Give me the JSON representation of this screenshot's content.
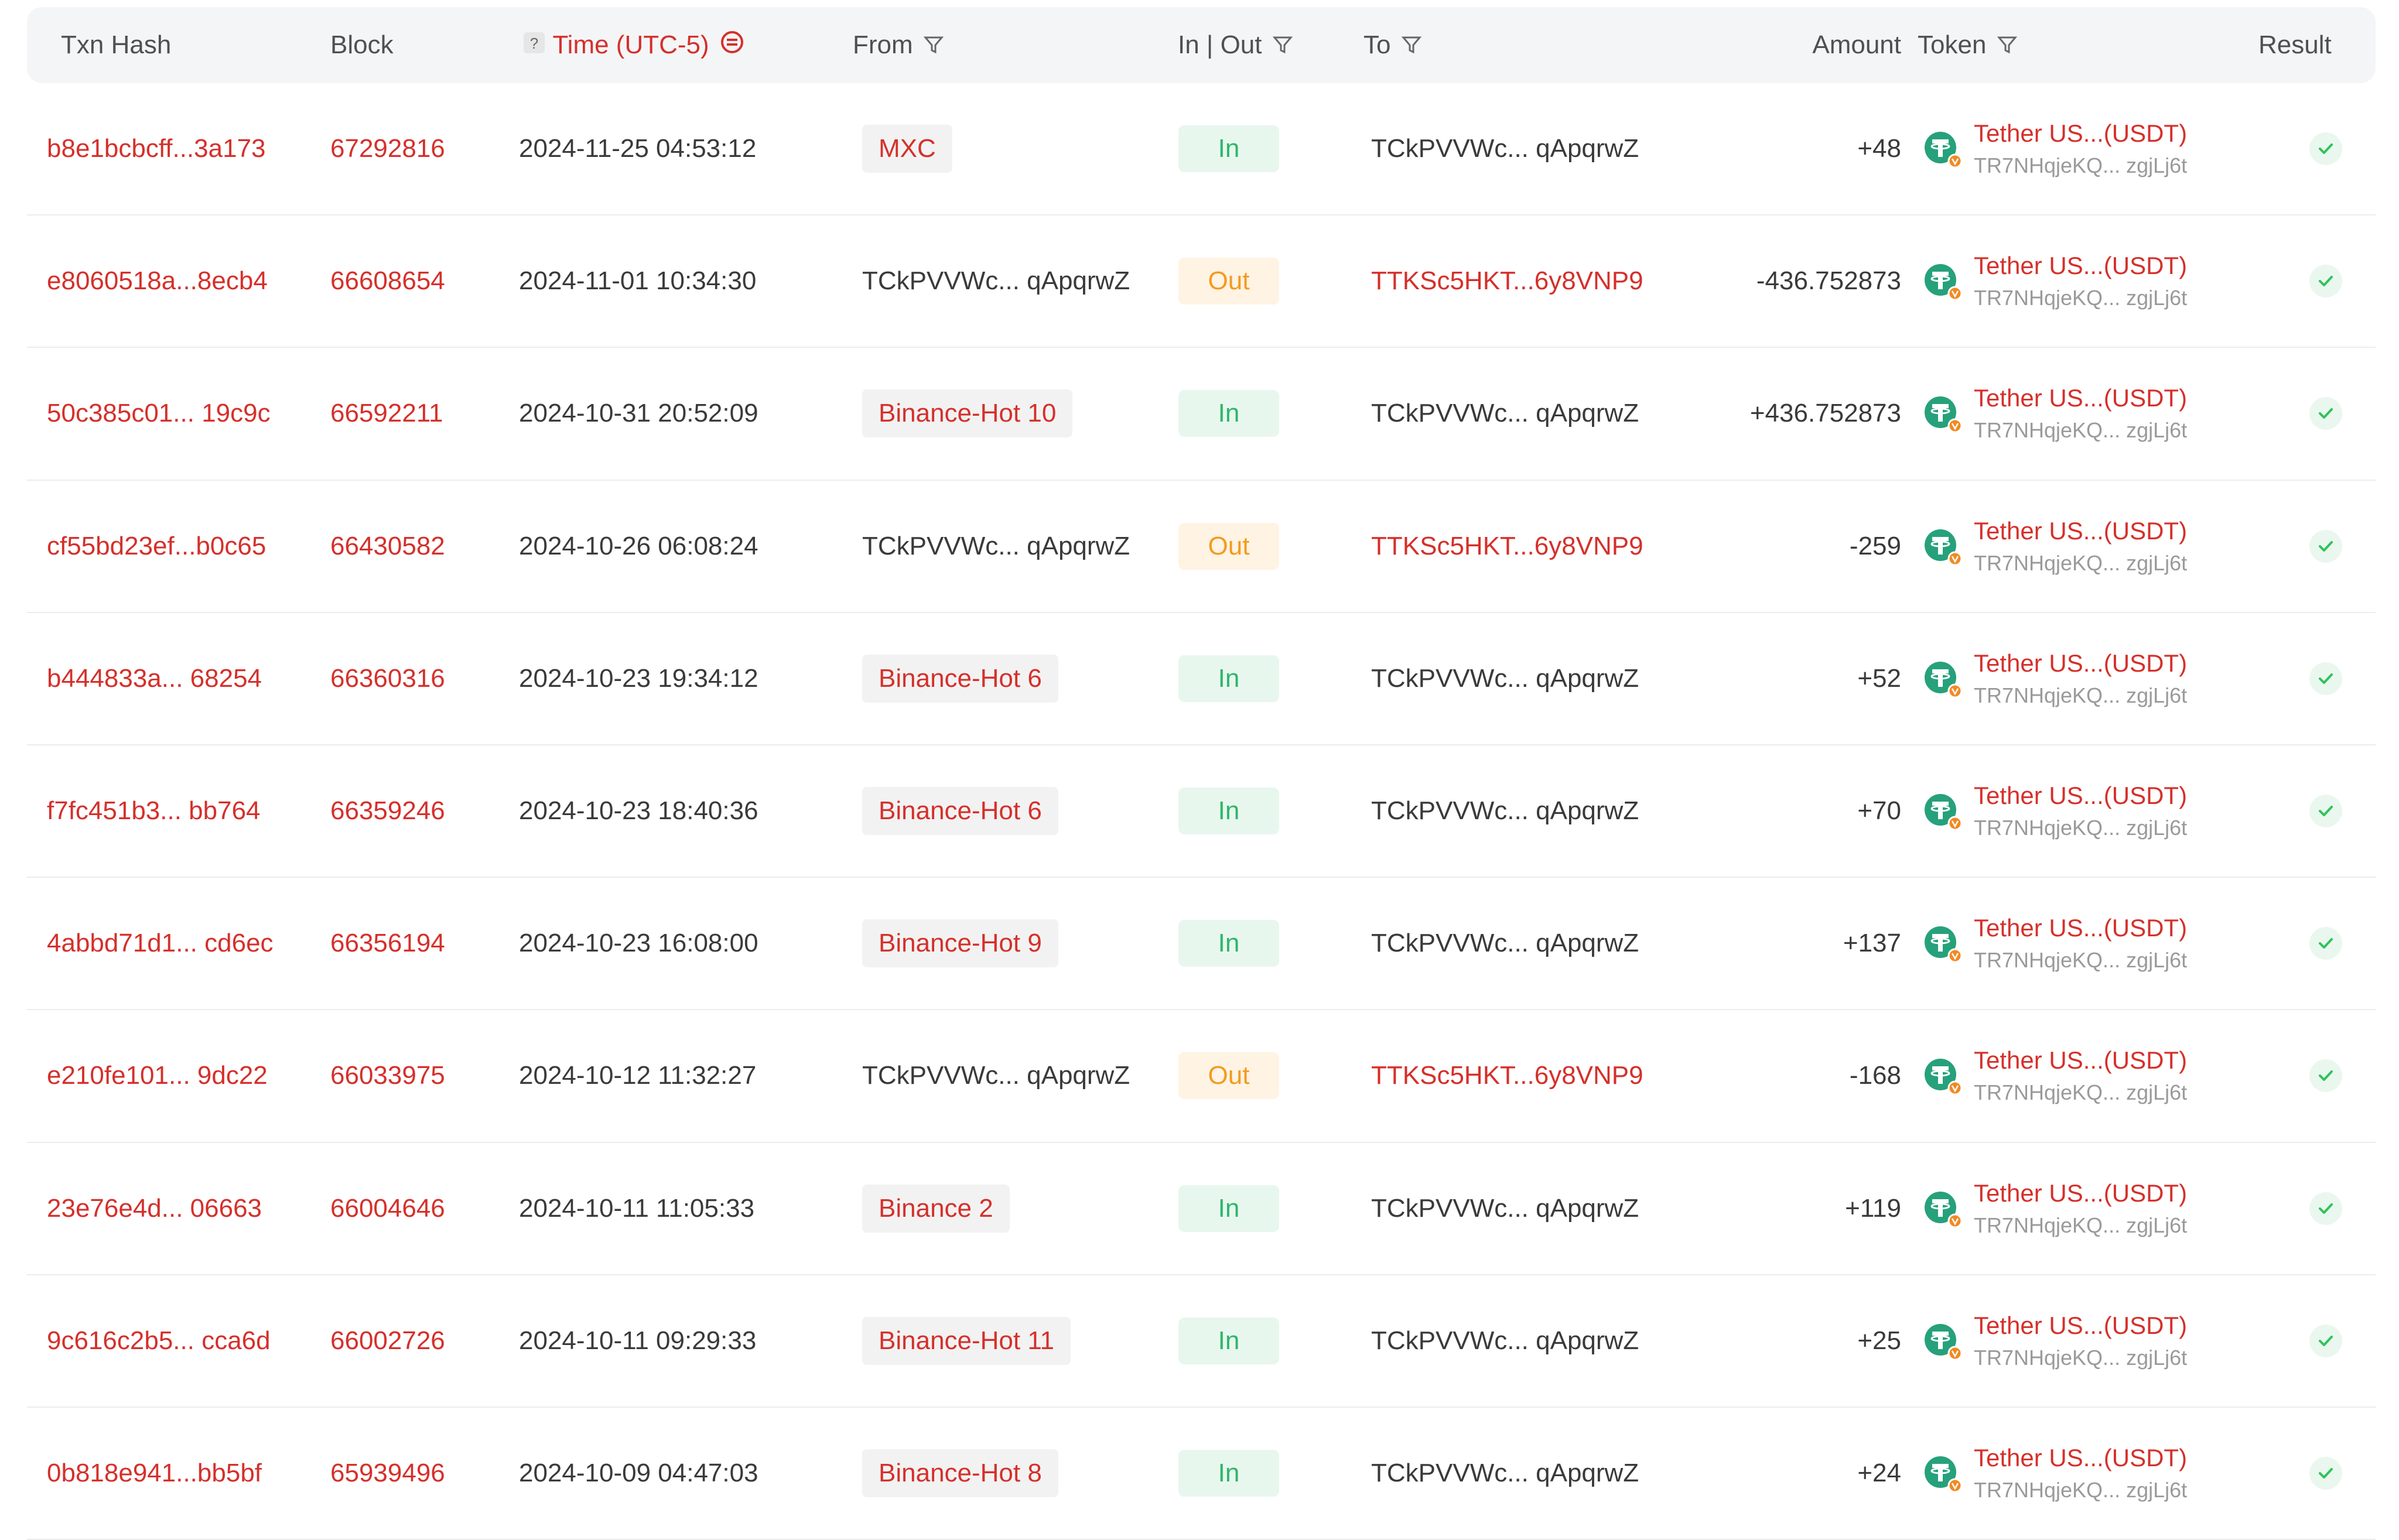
{
  "columns": {
    "txn_hash": "Txn Hash",
    "block": "Block",
    "time": "Time (UTC-5)",
    "from": "From",
    "in_out": "In | Out",
    "to": "To",
    "amount": "Amount",
    "token": "Token",
    "result": "Result"
  },
  "colors": {
    "accent": "#d5302b",
    "in": "#2eb66a",
    "out": "#f29b1f",
    "tether": "#26a17b"
  },
  "rows": [
    {
      "hash": "b8e1bcbcff...3a173",
      "block": "67292816",
      "time": "2024-11-25 04:53:12",
      "from": "MXC",
      "from_tag": true,
      "dir": "In",
      "to": "TCkPVVWc... qApqrwZ",
      "to_red": false,
      "amount": "+48",
      "token": "Tether US...(USDT)",
      "token_addr": "TR7NHqjeKQ... zgjLj6t"
    },
    {
      "hash": "e8060518a...8ecb4",
      "block": "66608654",
      "time": "2024-11-01 10:34:30",
      "from": "TCkPVVWc... qApqrwZ",
      "from_tag": false,
      "dir": "Out",
      "to": "TTKSc5HKT...6y8VNP9",
      "to_red": true,
      "amount": "-436.752873",
      "token": "Tether US...(USDT)",
      "token_addr": "TR7NHqjeKQ... zgjLj6t"
    },
    {
      "hash": "50c385c01... 19c9c",
      "block": "66592211",
      "time": "2024-10-31 20:52:09",
      "from": "Binance-Hot 10",
      "from_tag": true,
      "dir": "In",
      "to": "TCkPVVWc... qApqrwZ",
      "to_red": false,
      "amount": "+436.752873",
      "token": "Tether US...(USDT)",
      "token_addr": "TR7NHqjeKQ... zgjLj6t"
    },
    {
      "hash": "cf55bd23ef...b0c65",
      "block": "66430582",
      "time": "2024-10-26 06:08:24",
      "from": "TCkPVVWc... qApqrwZ",
      "from_tag": false,
      "dir": "Out",
      "to": "TTKSc5HKT...6y8VNP9",
      "to_red": true,
      "amount": "-259",
      "token": "Tether US...(USDT)",
      "token_addr": "TR7NHqjeKQ... zgjLj6t"
    },
    {
      "hash": "b444833a... 68254",
      "block": "66360316",
      "time": "2024-10-23 19:34:12",
      "from": "Binance-Hot 6",
      "from_tag": true,
      "dir": "In",
      "to": "TCkPVVWc... qApqrwZ",
      "to_red": false,
      "amount": "+52",
      "token": "Tether US...(USDT)",
      "token_addr": "TR7NHqjeKQ... zgjLj6t"
    },
    {
      "hash": "f7fc451b3... bb764",
      "block": "66359246",
      "time": "2024-10-23 18:40:36",
      "from": "Binance-Hot 6",
      "from_tag": true,
      "dir": "In",
      "to": "TCkPVVWc... qApqrwZ",
      "to_red": false,
      "amount": "+70",
      "token": "Tether US...(USDT)",
      "token_addr": "TR7NHqjeKQ... zgjLj6t"
    },
    {
      "hash": "4abbd71d1... cd6ec",
      "block": "66356194",
      "time": "2024-10-23 16:08:00",
      "from": "Binance-Hot 9",
      "from_tag": true,
      "dir": "In",
      "to": "TCkPVVWc... qApqrwZ",
      "to_red": false,
      "amount": "+137",
      "token": "Tether US...(USDT)",
      "token_addr": "TR7NHqjeKQ... zgjLj6t"
    },
    {
      "hash": "e210fe101... 9dc22",
      "block": "66033975",
      "time": "2024-10-12 11:32:27",
      "from": "TCkPVVWc... qApqrwZ",
      "from_tag": false,
      "dir": "Out",
      "to": "TTKSc5HKT...6y8VNP9",
      "to_red": true,
      "amount": "-168",
      "token": "Tether US...(USDT)",
      "token_addr": "TR7NHqjeKQ... zgjLj6t"
    },
    {
      "hash": "23e76e4d... 06663",
      "block": "66004646",
      "time": "2024-10-11 11:05:33",
      "from": "Binance 2",
      "from_tag": true,
      "dir": "In",
      "to": "TCkPVVWc... qApqrwZ",
      "to_red": false,
      "amount": "+119",
      "token": "Tether US...(USDT)",
      "token_addr": "TR7NHqjeKQ... zgjLj6t"
    },
    {
      "hash": "9c616c2b5... cca6d",
      "block": "66002726",
      "time": "2024-10-11 09:29:33",
      "from": "Binance-Hot 11",
      "from_tag": true,
      "dir": "In",
      "to": "TCkPVVWc... qApqrwZ",
      "to_red": false,
      "amount": "+25",
      "token": "Tether US...(USDT)",
      "token_addr": "TR7NHqjeKQ... zgjLj6t"
    },
    {
      "hash": "0b818e941...bb5bf",
      "block": "65939496",
      "time": "2024-10-09 04:47:03",
      "from": "Binance-Hot 8",
      "from_tag": true,
      "dir": "In",
      "to": "TCkPVVWc... qApqrwZ",
      "to_red": false,
      "amount": "+24",
      "token": "Tether US...(USDT)",
      "token_addr": "TR7NHqjeKQ... zgjLj6t"
    }
  ]
}
